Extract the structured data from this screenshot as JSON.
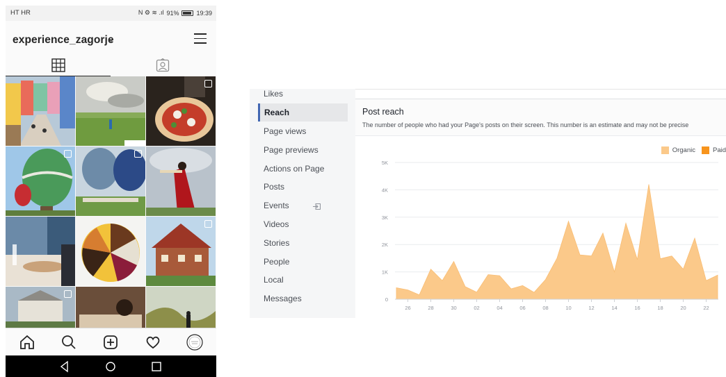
{
  "phone": {
    "status": {
      "carrier": "HT HR",
      "icons": "N  ⚙  ≋  .ıl",
      "battery": "91%",
      "time": "19:39"
    },
    "profile": {
      "username": "experience_zagorje",
      "chevron": "⌄"
    },
    "tabs": [
      {
        "name": "grid",
        "icon": "grid-icon",
        "active": true
      },
      {
        "name": "tagged",
        "icon": "tagged-icon",
        "active": false
      }
    ],
    "grid_posts": [
      {
        "scene": "colorful-town-street",
        "multi": false
      },
      {
        "scene": "field-with-cloudy-sky",
        "multi": false
      },
      {
        "scene": "pizza-dish",
        "multi": true
      },
      {
        "scene": "green-hot-air-balloon",
        "multi": true
      },
      {
        "scene": "two-hot-air-balloons",
        "multi": true
      },
      {
        "scene": "dancer-in-red",
        "multi": false
      },
      {
        "scene": "restaurant-table",
        "multi": false
      },
      {
        "scene": "round-cake",
        "multi": false
      },
      {
        "scene": "red-wooden-house",
        "multi": true
      },
      {
        "scene": "castle-on-hill",
        "multi": true
      },
      {
        "scene": "table-with-coffee",
        "multi": false
      },
      {
        "scene": "person-in-woods",
        "multi": false
      }
    ],
    "bottom_nav": [
      "home-icon",
      "search-icon",
      "add-post-icon",
      "heart-icon",
      "profile-avatar"
    ],
    "android_nav": [
      "back-icon",
      "home-circle-icon",
      "recents-icon"
    ]
  },
  "insights": {
    "sidebar": {
      "items": [
        "Likes",
        "Reach",
        "Page views",
        "Page previews",
        "Actions on Page",
        "Posts",
        "Events",
        "Videos",
        "Stories",
        "People",
        "Local",
        "Messages"
      ],
      "active": "Reach"
    },
    "card": {
      "title": "Post reach",
      "description": "The number of people who had your Page's posts on their screen. This number is an estimate and may not be precise"
    },
    "colors": {
      "organic": "#fbc98a",
      "paid": "#f7941d",
      "accent": "#4267b2"
    }
  },
  "chart_data": {
    "type": "area",
    "series": [
      {
        "name": "Organic",
        "values": [
          420,
          340,
          160,
          1100,
          680,
          1380,
          460,
          260,
          900,
          860,
          380,
          500,
          250,
          720,
          1500,
          2850,
          1620,
          1580,
          2420,
          1000,
          2780,
          1450,
          4200,
          1480,
          1580,
          1100,
          2230,
          680,
          880
        ]
      },
      {
        "name": "Paid",
        "values": []
      }
    ],
    "x_ticks": [
      "26",
      "28",
      "30",
      "02",
      "04",
      "06",
      "08",
      "10",
      "12",
      "14",
      "16",
      "18",
      "20",
      "22"
    ],
    "y_ticks": [
      "0",
      "1K",
      "2K",
      "3K",
      "4K",
      "5K"
    ],
    "ylim": [
      0,
      5000
    ],
    "grid": true,
    "legend": "top-right"
  }
}
